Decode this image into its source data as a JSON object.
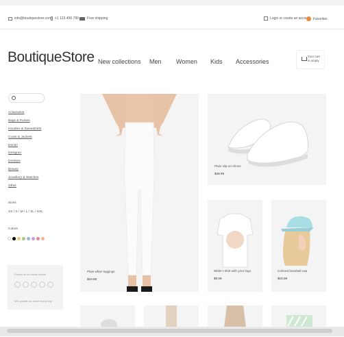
{
  "topbar": {
    "email": "info@boutiquestore.com",
    "phone": "+1 123 456 789",
    "shipping": "Free shipping",
    "login": "Login or create an account",
    "favorites": "Favorites"
  },
  "brand": {
    "logo": "BoutiqueStore"
  },
  "nav": [
    "New collections",
    "Men",
    "Women",
    "Kids",
    "Accessories"
  ],
  "cart": {
    "text": "Your cart is empty"
  },
  "sidebar": {
    "categories": [
      "Activewear",
      "Bags & Purses",
      "Hoodies & Sweatshirts",
      "Coats & Jackets",
      "Denim",
      "Designer",
      "Dresses",
      "Beauty",
      "Jewellery & Watches",
      "Other"
    ],
    "sizes_label": "Sizes",
    "sizes": "XS / S / M / L / XL / XXL",
    "colors_label": "Colors",
    "colors": [
      "#ffffff",
      "#000000",
      "#e8c77f",
      "#a6c98b",
      "#9ab3e0",
      "#c6a0d9",
      "#e08b8b",
      "#f0b38a"
    ],
    "social_title": "Follow us on social media",
    "social_note": "We update our store every day"
  },
  "products": [
    {
      "name": "Plain white leggings",
      "price": "$19.99"
    },
    {
      "name": "Plain slip-on shoes",
      "price": "$49.99"
    },
    {
      "name": "White t-shirt with your logo",
      "price": "$9.99"
    },
    {
      "name": "Colored baseball cap",
      "price": "$15.99"
    }
  ]
}
